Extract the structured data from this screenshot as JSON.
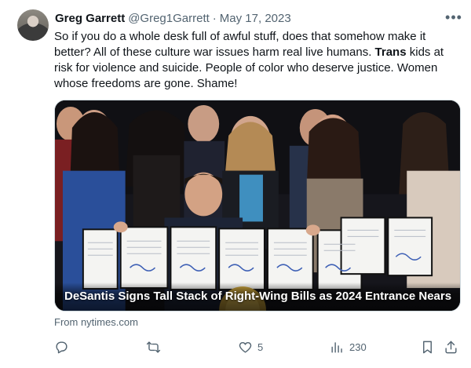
{
  "author": {
    "display_name": "Greg Garrett",
    "handle": "@Greg1Garrett",
    "separator": "·",
    "date": "May 17, 2023"
  },
  "body": {
    "part1": "So if you do a whole desk full of awful stuff, does that somehow make it better? All of these culture war issues harm real live humans. ",
    "bold": "Trans",
    "part2": " kids at risk for violence and suicide. People of color who deserve justice. Women whose freedoms are gone. Shame!"
  },
  "media": {
    "caption": "DeSantis Signs Tall Stack of Right-Wing Bills as 2024 Entrance Nears"
  },
  "source": "From nytimes.com",
  "actions": {
    "reply": {
      "icon": "reply-icon",
      "count": ""
    },
    "retweet": {
      "icon": "retweet-icon",
      "count": ""
    },
    "like": {
      "icon": "heart-icon",
      "count": "5"
    },
    "views": {
      "icon": "views-icon",
      "count": "230"
    },
    "bookmark": {
      "icon": "bookmark-icon"
    },
    "share": {
      "icon": "share-icon"
    }
  },
  "colors": {
    "text": "#0f1419",
    "muted": "#536471",
    "border": "#cfd9de"
  }
}
